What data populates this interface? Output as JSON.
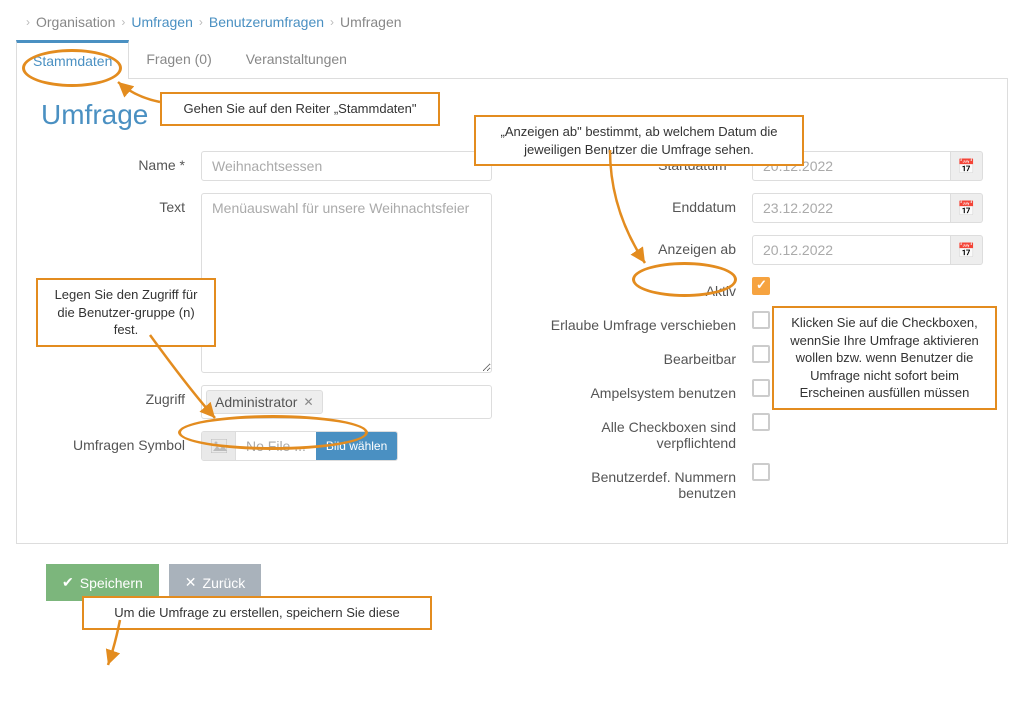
{
  "breadcrumb": {
    "items": [
      "Organisation",
      "Umfragen",
      "Benutzerumfragen",
      "Umfragen"
    ]
  },
  "tabs": {
    "stammdaten": "Stammdaten",
    "fragen": "Fragen (0)",
    "veranstaltungen": "Veranstaltungen"
  },
  "page_title": "Umfrage",
  "labels": {
    "name": "Name *",
    "text": "Text",
    "zugriff": "Zugriff",
    "symbol": "Umfragen Symbol",
    "startdatum": "Startdatum *",
    "enddatum": "Enddatum",
    "anzeigen_ab": "Anzeigen ab",
    "aktiv": "Aktiv",
    "verschieben": "Erlaube Umfrage verschieben",
    "bearbeitbar": "Bearbeitbar",
    "ampel": "Ampelsystem benutzen",
    "alle_cb": "Alle Checkboxen sind verpflichtend",
    "benutzerdef": "Benutzerdef. Nummern benutzen"
  },
  "values": {
    "name": "Weihnachtsessen",
    "text": "Menüauswahl für unsere Weihnachtsfeier",
    "zugriff_tag": "Administrator",
    "file_name": "No File ...",
    "file_btn": "Bild wählen",
    "startdatum": "20.12.2022",
    "enddatum": "23.12.2022",
    "anzeigen_ab": "20.12.2022"
  },
  "buttons": {
    "speichern": "Speichern",
    "zurueck": "Zurück"
  },
  "annotations": {
    "tab_hint": "Gehen Sie auf den Reiter „Stammdaten\"",
    "zugriff_hint": "Legen Sie den Zugriff für die Benutzer-gruppe (n) fest.",
    "anzeigen_hint": "„Anzeigen ab\" bestimmt, ab welchem Datum die jeweiligen Benutzer die Umfrage sehen.",
    "aktiv_hint": "Klicken Sie auf die Checkboxen, wennSie Ihre Umfrage aktivieren wollen bzw. wenn Benutzer die Umfrage nicht sofort beim Erscheinen ausfüllen müssen",
    "speichern_hint": "Um die Umfrage zu erstellen, speichern Sie diese"
  }
}
